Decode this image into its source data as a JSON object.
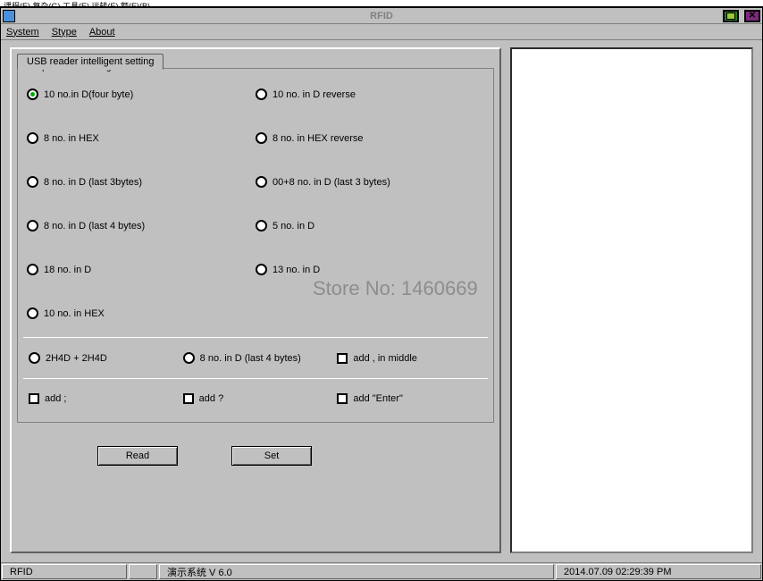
{
  "titlebarTop": "课程(E)   复杂(G)   工具(E)   运转(E)   额(E)(B)",
  "window": {
    "title": "RFID"
  },
  "menu": {
    "items": [
      "System",
      "Stype",
      "About"
    ]
  },
  "tab": {
    "label": "USB reader intelligent setting"
  },
  "fieldset": {
    "legend": "Output format setting"
  },
  "radios": {
    "r1": "10 no.in D(four byte)",
    "r2": "10 no. in D reverse",
    "r3": "8 no. in HEX",
    "r4": "8 no. in HEX reverse",
    "r5": "8 no. in D (last 3bytes)",
    "r6": "00+8 no. in D (last 3 bytes)",
    "r7": "8 no. in D (last 4 bytes)",
    "r8": "5 no. in D",
    "r9": "18 no. in D",
    "r10": "13 no. in D",
    "r11": "10 no. in HEX",
    "r12": "2H4D + 2H4D",
    "r13": "8 no. in D (last 4 bytes)"
  },
  "checks": {
    "c1": "add , in middle",
    "c2": "add ;",
    "c3": "add ?",
    "c4": "add \"Enter\""
  },
  "buttons": {
    "read": "Read",
    "set": "Set"
  },
  "status": {
    "s1": "RFID",
    "s2": "",
    "s3": "演示系统  V 6.0",
    "s4": "2014.07.09   02:29:39 PM"
  },
  "watermark": "Store No: 1460669"
}
